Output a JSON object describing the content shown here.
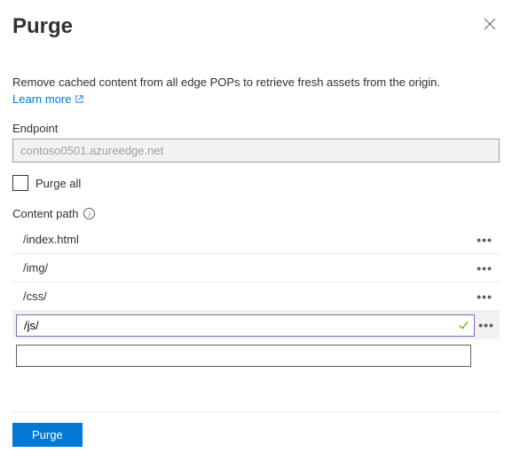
{
  "header": {
    "title": "Purge"
  },
  "description": "Remove cached content from all edge POPs to retrieve fresh assets from the origin.",
  "learn_more": "Learn more",
  "endpoint": {
    "label": "Endpoint",
    "value": "contoso0501.azureedge.net"
  },
  "purge_all": {
    "label": "Purge all",
    "checked": false
  },
  "content_path": {
    "label": "Content path",
    "rows": [
      {
        "value": "/index.html"
      },
      {
        "value": "/img/"
      },
      {
        "value": "/css/"
      }
    ],
    "active": {
      "value": "/js/"
    },
    "empty": {
      "value": ""
    }
  },
  "footer": {
    "purge_button": "Purge"
  }
}
